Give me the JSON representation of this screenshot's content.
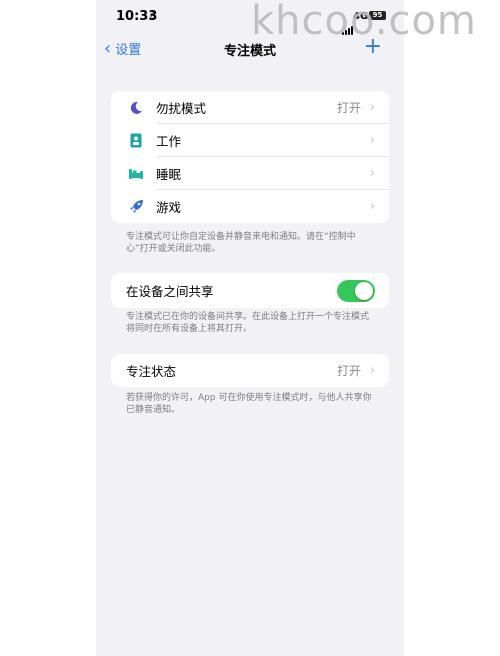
{
  "watermark": "khcoo.com",
  "status_bar": {
    "time": "10:33",
    "network": "4G",
    "battery": "95"
  },
  "nav": {
    "back_label": "设置",
    "title": "专注模式",
    "add_icon": "plus-icon"
  },
  "focus_modes": [
    {
      "label": "勿扰模式",
      "value": "打开",
      "icon": "moon-icon",
      "color": "#5a4bd6"
    },
    {
      "label": "工作",
      "value": "",
      "icon": "badge-icon",
      "color": "#1aa7a0"
    },
    {
      "label": "睡眠",
      "value": "",
      "icon": "bed-icon",
      "color": "#1fb6a8"
    },
    {
      "label": "游戏",
      "value": "",
      "icon": "rocket-icon",
      "color": "#2f6fe1"
    }
  ],
  "focus_note": "专注模式可让你自定设备并静音来电和通知。请在“控制中心”打开或关闭此功能。",
  "share": {
    "label": "在设备之间共享",
    "on": true
  },
  "share_note": "专注模式已在你的设备间共享。在此设备上打开一个专注模式将同时在所有设备上将其打开。",
  "focus_status": {
    "label": "专注状态",
    "value": "打开"
  },
  "status_note": "若获得你的许可，App 可在你使用专注模式时，与他人共享你已静音通知。",
  "colors": {
    "accent": "#2f7de1",
    "toggle_on": "#34c759",
    "background": "#f1f1f6"
  }
}
